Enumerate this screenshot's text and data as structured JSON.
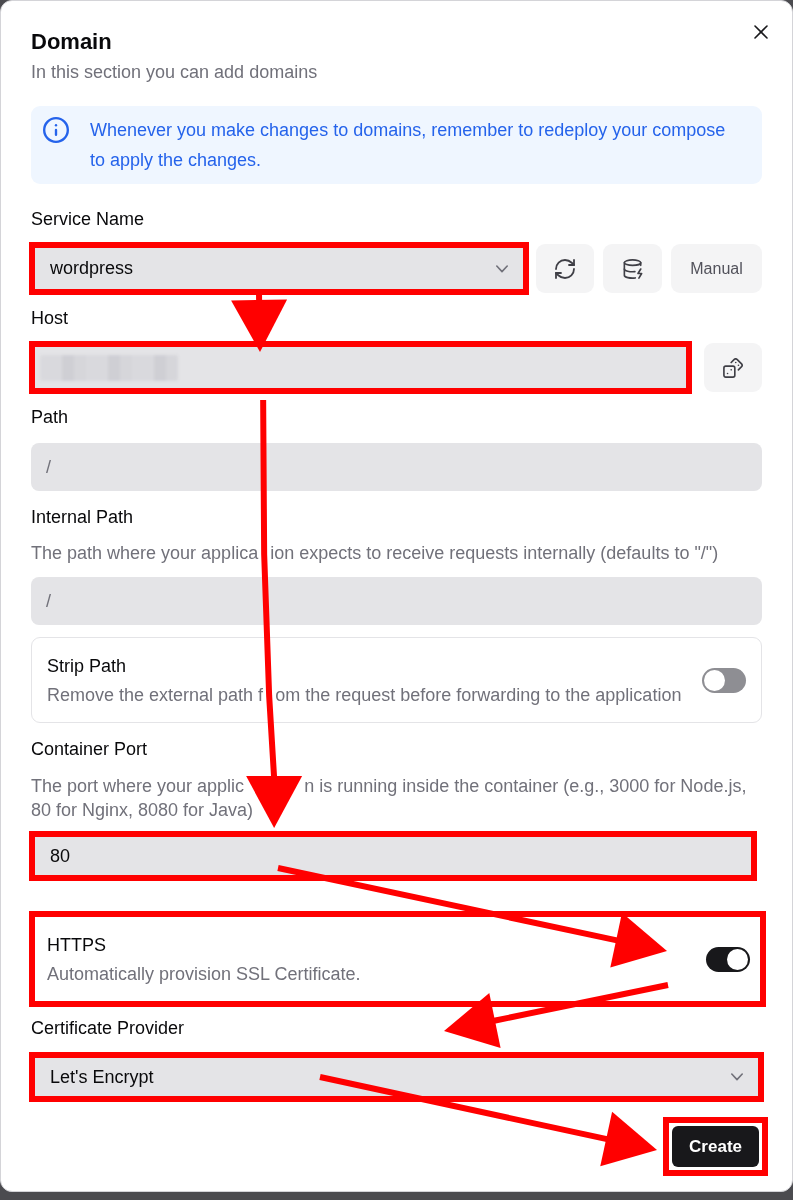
{
  "dialog": {
    "title": "Domain",
    "subtitle": "In this section you can add domains"
  },
  "notice": {
    "text": "Whenever you make changes to domains, remember to redeploy your compose to apply the changes."
  },
  "service": {
    "label": "Service Name",
    "select": {
      "value": "wordpress",
      "highlighted": true
    },
    "buttons": [
      {
        "kind": "refresh"
      },
      {
        "kind": "database"
      },
      {
        "kind": "text",
        "label": "Manual"
      }
    ]
  },
  "host": {
    "label": "Host",
    "field": {
      "obscured": true,
      "highlighted": true
    },
    "buttons": [
      {
        "kind": "dice"
      }
    ]
  },
  "path": {
    "label": "Path",
    "field": {
      "placeholder": "/"
    }
  },
  "internal_path": {
    "label": "Internal Path",
    "description": [
      "The path where your applica",
      "ion expects to receive requests internally (defaults to \"/\")"
    ],
    "field": {
      "placeholder": "/"
    }
  },
  "strip_path": {
    "title": "Strip Path",
    "description": [
      "Remove the external path f",
      "om the request before forwarding to the application"
    ],
    "on": false
  },
  "container_port": {
    "label": "Container Port",
    "description": [
      "The port where your applic",
      "n is running inside the container (e.g., 3000 for Node.js, 80 for Nginx, 8080 for Java)"
    ],
    "field": {
      "value": "80",
      "highlighted": true
    }
  },
  "https": {
    "title": "HTTPS",
    "description": [
      "Automatically provision SSL Certificate."
    ],
    "on": true,
    "highlighted": true
  },
  "certificate_provider": {
    "label": "Certificate Provider",
    "select": {
      "value": "Let's Encrypt",
      "highlighted": true
    }
  },
  "submit": {
    "label": "Create",
    "highlighted": true
  }
}
